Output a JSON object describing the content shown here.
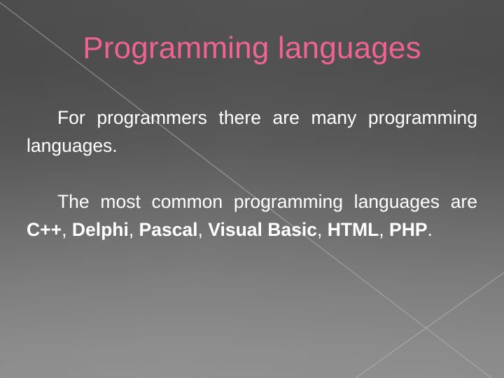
{
  "slide": {
    "title": "Programming languages",
    "title_color": "#ef5f8e",
    "background": {
      "top_color": "#4b4b4b",
      "bottom_color": "#8d8d8d",
      "decoration": "diagonal-line-pattern",
      "line_color": "#b9b9b9"
    },
    "body": {
      "text_color": "#ffffff",
      "paragraphs": [
        {
          "id": "intro",
          "runs": [
            {
              "text": "For programmers there are many programming languages.",
              "bold": false
            }
          ]
        },
        {
          "id": "common-languages",
          "runs": [
            {
              "text": "The most common programming languages are ",
              "bold": false
            },
            {
              "text": "C++",
              "bold": true
            },
            {
              "text": ", ",
              "bold": false
            },
            {
              "text": "Delphi",
              "bold": true
            },
            {
              "text": ", ",
              "bold": false
            },
            {
              "text": "Pascal",
              "bold": true
            },
            {
              "text": ", ",
              "bold": false
            },
            {
              "text": "Visual Basic",
              "bold": true
            },
            {
              "text": ", ",
              "bold": false
            },
            {
              "text": "HTML",
              "bold": true
            },
            {
              "text": ", ",
              "bold": false
            },
            {
              "text": "PHP",
              "bold": true
            },
            {
              "text": ".",
              "bold": false
            }
          ]
        }
      ]
    }
  }
}
